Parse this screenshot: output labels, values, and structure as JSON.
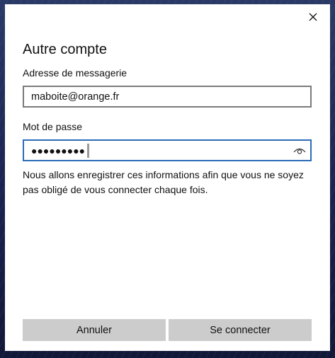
{
  "dialog": {
    "title": "Autre compte",
    "email_label": "Adresse de messagerie",
    "email_value": "maboite@orange.fr",
    "password_label": "Mot de passe",
    "password_masked": "●●●●●●●●●",
    "info_text": "Nous allons enregistrer ces informations afin que vous ne soyez pas obligé de vous connecter chaque fois.",
    "cancel_label": "Annuler",
    "connect_label": "Se connecter"
  },
  "icons": {
    "close": "close-icon",
    "reveal": "eye-icon"
  },
  "colors": {
    "focus_border": "#2b6cb8",
    "button_bg": "#cccccc",
    "field_border": "#7a7a7a"
  }
}
